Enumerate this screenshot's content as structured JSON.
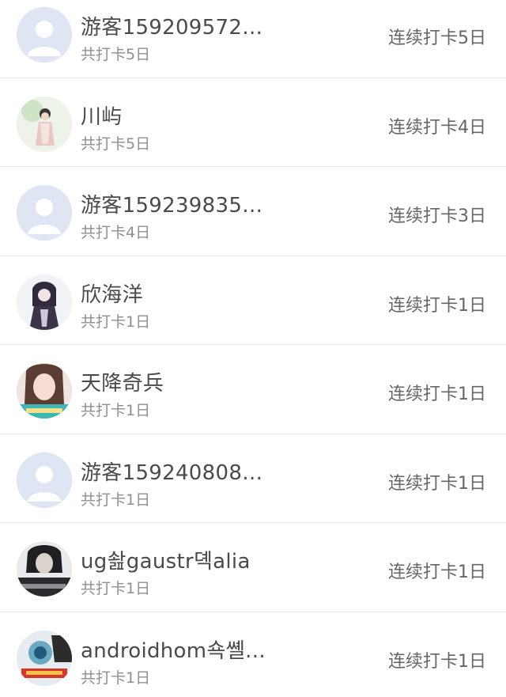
{
  "rows": [
    {
      "name": "游客159209572…",
      "total": "共打卡5日",
      "streak": "连续打卡5日",
      "avatar": "default-avatar"
    },
    {
      "name": "川屿",
      "total": "共打卡5日",
      "streak": "连续打卡4日",
      "avatar": "photo-avatar"
    },
    {
      "name": "游客159239835…",
      "total": "共打卡4日",
      "streak": "连续打卡3日",
      "avatar": "default-avatar"
    },
    {
      "name": "欣海洋",
      "total": "共打卡1日",
      "streak": "连续打卡1日",
      "avatar": "photo-avatar"
    },
    {
      "name": "天降奇兵",
      "total": "共打卡1日",
      "streak": "连续打卡1日",
      "avatar": "photo-avatar"
    },
    {
      "name": "游客159240808…",
      "total": "共打卡1日",
      "streak": "连续打卡1日",
      "avatar": "default-avatar"
    },
    {
      "name": "ug솶gaustr뎩alia",
      "total": "共打卡1日",
      "streak": "连续打卡1日",
      "avatar": "photo-avatar"
    },
    {
      "name": "androidhom쇽쏄…",
      "total": "共打卡1日",
      "streak": "连续打卡1日",
      "avatar": "photo-avatar"
    }
  ]
}
